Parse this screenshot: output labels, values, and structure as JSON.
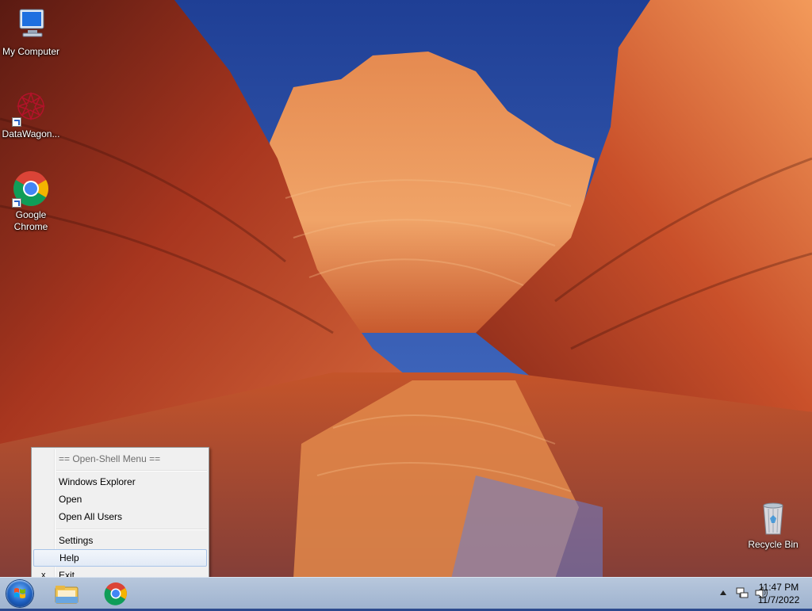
{
  "desktop": {
    "icons": [
      {
        "label": "My Computer"
      },
      {
        "label": "DataWagon..."
      },
      {
        "label": "Google Chrome"
      },
      {
        "label": "Recycle Bin"
      }
    ]
  },
  "context_menu": {
    "header": "== Open-Shell Menu ==",
    "items": [
      {
        "label": "Windows Explorer"
      },
      {
        "label": "Open"
      },
      {
        "label": "Open All Users"
      },
      {
        "label": "Settings"
      },
      {
        "label": "Help"
      },
      {
        "label": "Exit"
      }
    ],
    "exit_mark": "x"
  },
  "taskbar": {
    "apps": [
      "file-explorer-icon",
      "chrome-icon"
    ],
    "tray_icons": [
      "show-hidden-icons-icon",
      "network-icon",
      "volume-icon"
    ],
    "clock": {
      "time": "11:47 PM",
      "date": "11/7/2022"
    }
  }
}
